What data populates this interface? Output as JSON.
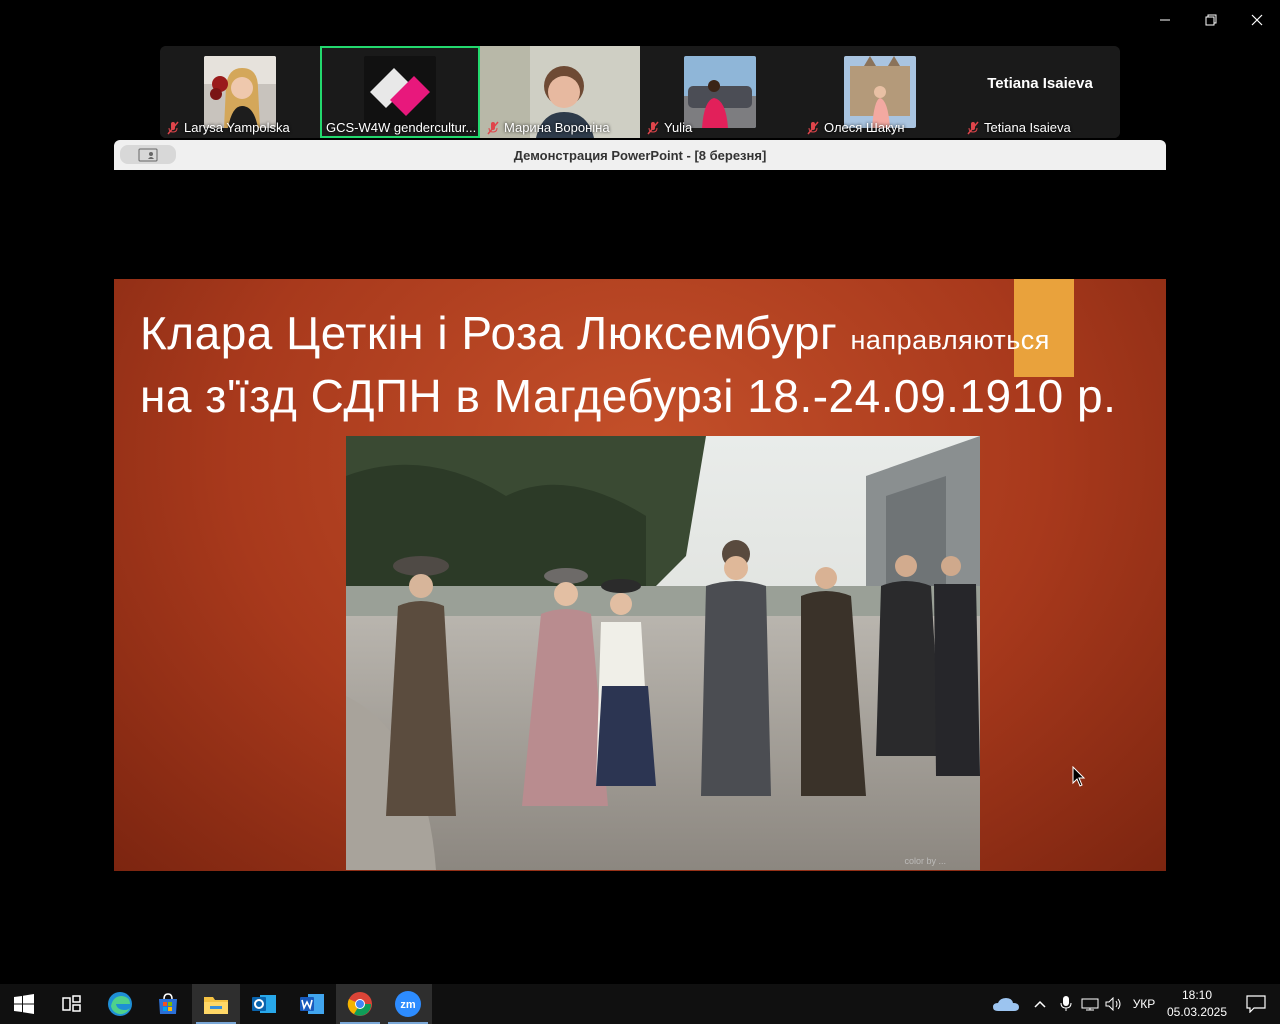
{
  "participants": [
    {
      "name": "Larysa Yampolska",
      "muted": true
    },
    {
      "name": "GCS-W4W genderculturecentre",
      "display_name": "GCS-W4W gendercultur...",
      "muted": false,
      "active": true
    },
    {
      "name": "Марина Вороніна",
      "muted": true
    },
    {
      "name": "Yulia",
      "muted": true
    },
    {
      "name": "Олеся Шакун",
      "muted": true
    },
    {
      "name": "Tetiana Isaieva",
      "muted": true,
      "video_off": true
    }
  ],
  "share": {
    "title": "Демонстрация PowerPoint - [8 березня]"
  },
  "slide": {
    "title_line1_main": "Клара Цеткін і Роза Люксембург",
    "title_line1_small": "направляються",
    "title_line2": "на з'їзд СДПН в Магдебурзі 18.-24.09.1910 р.",
    "photo_credit": "color by ..."
  },
  "taskbar": {
    "apps": [
      {
        "name": "start",
        "icon": "windows-logo-icon"
      },
      {
        "name": "task-view",
        "icon": "task-view-icon"
      },
      {
        "name": "edge",
        "icon": "edge-icon"
      },
      {
        "name": "store",
        "icon": "store-icon"
      },
      {
        "name": "file-explorer",
        "icon": "folder-icon"
      },
      {
        "name": "outlook",
        "icon": "outlook-icon"
      },
      {
        "name": "word",
        "icon": "word-icon"
      },
      {
        "name": "chrome",
        "icon": "chrome-icon"
      },
      {
        "name": "zoom",
        "icon": "zoom-icon"
      }
    ],
    "tray": {
      "language": "УКР",
      "time": "18:10",
      "date": "05.03.2025"
    }
  },
  "colors": {
    "active_speaker": "#23d96e",
    "slide_bg": "#b5411f",
    "slide_accent": "#e9a23c",
    "muted_red": "#e0454b"
  }
}
